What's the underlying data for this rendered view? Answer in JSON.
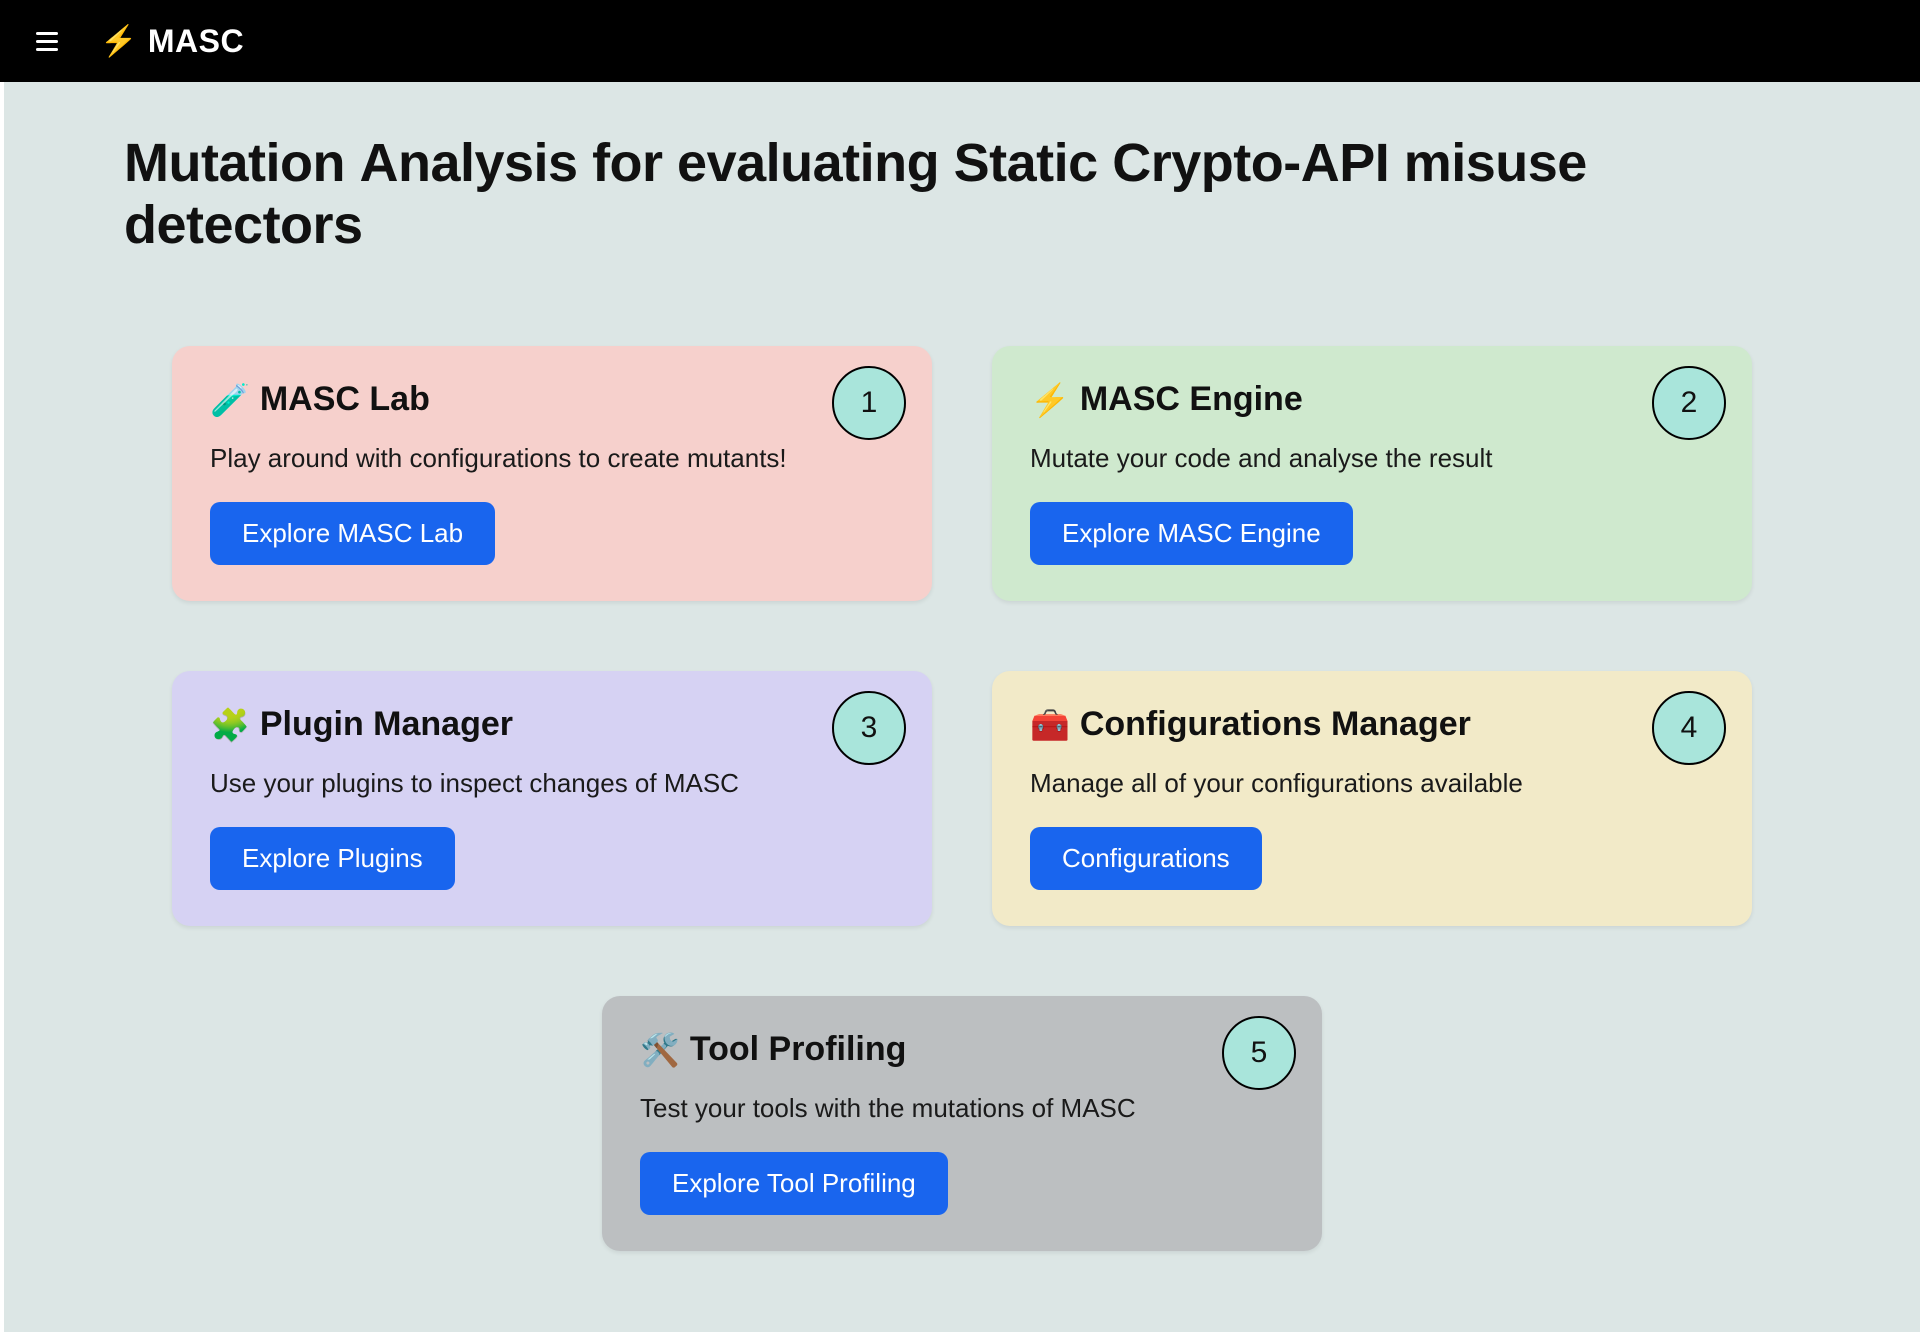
{
  "app": {
    "brand_icon": "⚡",
    "brand_name": "MASC"
  },
  "page": {
    "title_parts": {
      "M": "M",
      "utation": "utation ",
      "A": "A",
      "nalysis": "nalysis for evaluating ",
      "S": "S",
      "tatic": "tatic ",
      "C": "C",
      "rypto": "rypto-API misuse detectors"
    }
  },
  "cards": [
    {
      "badge": "1",
      "icon": "🧪",
      "title": "MASC Lab",
      "desc": "Play around with configurations to create mutants!",
      "button": "Explore MASC Lab",
      "class": "card-pink"
    },
    {
      "badge": "2",
      "icon": "⚡",
      "title": "MASC Engine",
      "desc": "Mutate your code and analyse the result",
      "button": "Explore MASC Engine",
      "class": "card-green"
    },
    {
      "badge": "3",
      "icon": "🧩",
      "title": "Plugin Manager",
      "desc": "Use your plugins to inspect changes of MASC",
      "button": "Explore Plugins",
      "class": "card-purple"
    },
    {
      "badge": "4",
      "icon": "🧰",
      "title": "Configurations Manager",
      "desc": "Manage all of your configurations available",
      "button": "Configurations",
      "class": "card-yellow"
    },
    {
      "badge": "5",
      "icon": "🛠️",
      "title": "Tool Profiling",
      "desc": "Test your tools with the mutations of MASC",
      "button": "Explore Tool Profiling",
      "class": "card-grey"
    }
  ]
}
